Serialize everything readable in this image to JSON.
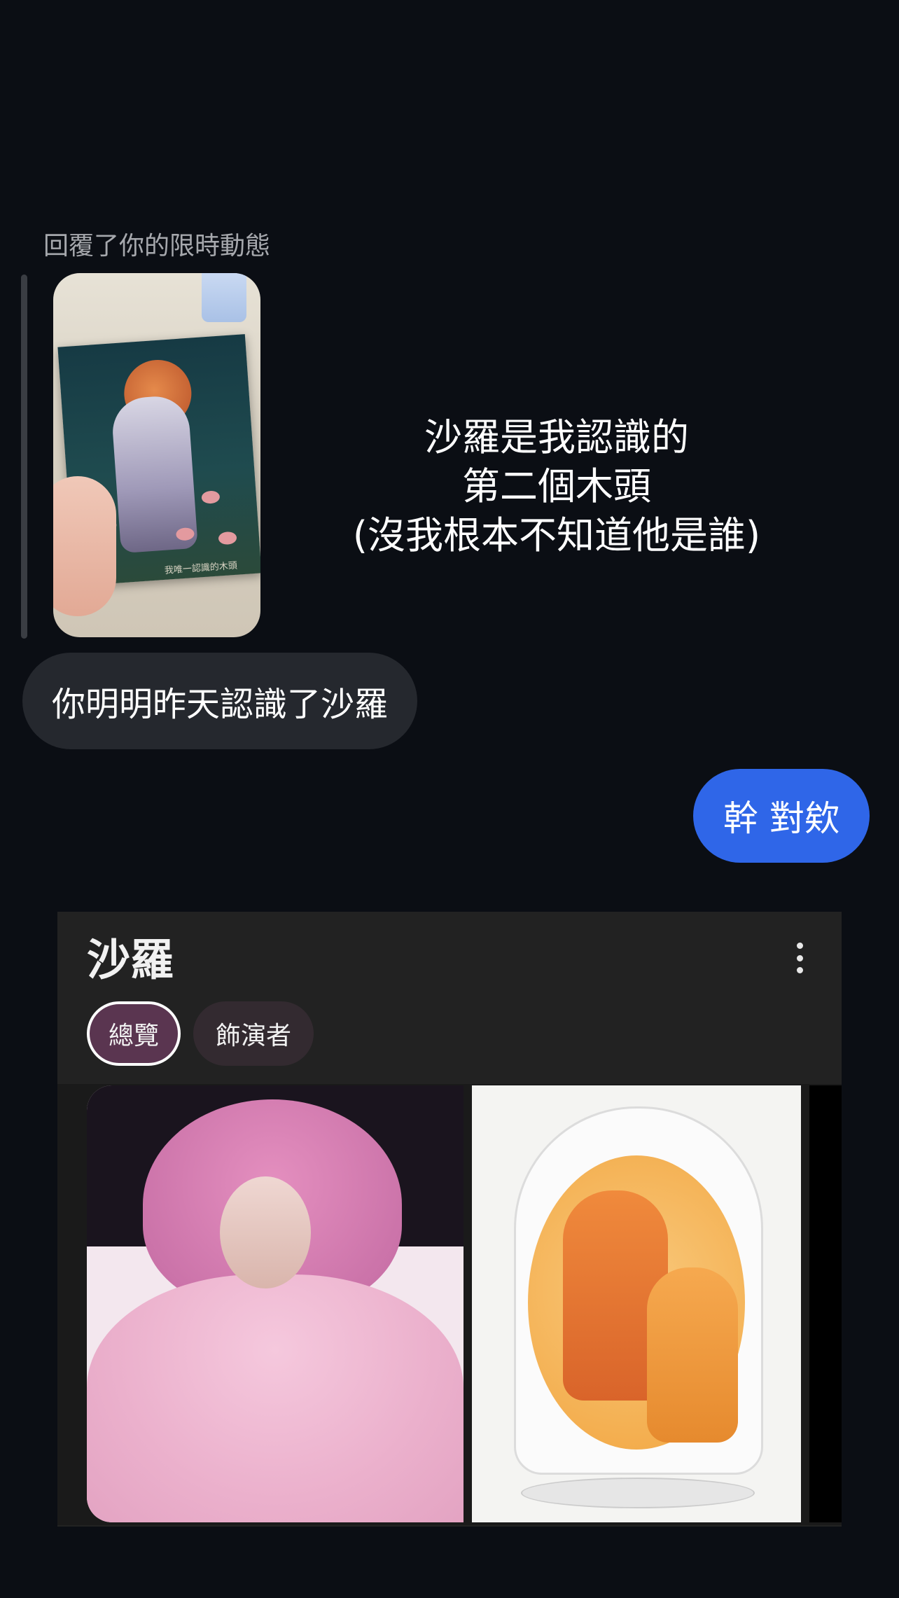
{
  "story_reply": {
    "caption": "回覆了你的限時動態",
    "story_thumbnail_text": "我唯一認識的木頭",
    "story_text_lines": [
      "沙羅是我認識的",
      "第二個木頭",
      "(沒我根本不知道他是誰)"
    ]
  },
  "messages": {
    "incoming": "你明明昨天認識了沙羅",
    "outgoing": "幹 對欸"
  },
  "search_card": {
    "title": "沙羅",
    "chips": [
      "總覽",
      "飾演者"
    ],
    "active_chip": "總覽",
    "menu_icon": "more-vertical-icon"
  },
  "colors": {
    "background": "#0b0e14",
    "incoming_bubble": "#25282e",
    "outgoing_bubble": "#2f66e8",
    "card_bg": "#222222",
    "chip_active_bg": "#5a3550",
    "chip_inactive_bg": "#332a30"
  }
}
